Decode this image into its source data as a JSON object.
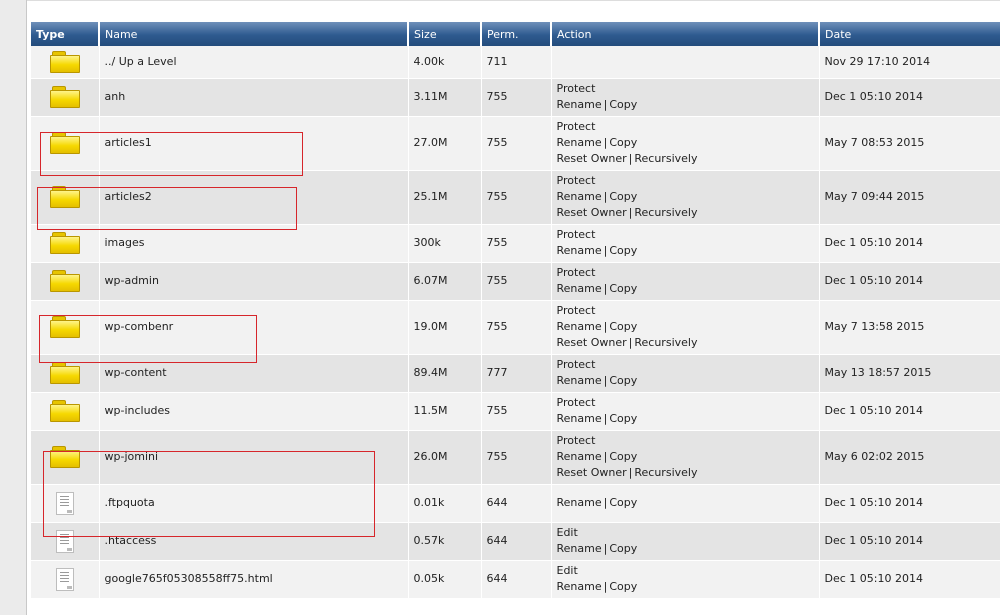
{
  "columns": {
    "type": "Type",
    "name": "Name",
    "size": "Size",
    "perm": "Perm.",
    "action": "Action",
    "date": "Date"
  },
  "actions": {
    "protect": "Protect",
    "rename": "Rename",
    "copy": "Copy",
    "reset_owner": "Reset Owner",
    "recursively": "Recursively",
    "edit": "Edit",
    "separator": "|"
  },
  "rows": [
    {
      "kind": "folder",
      "name": "../ Up a Level",
      "size": "4.00k",
      "perm": "711",
      "date": "Nov 29 17:10 2014",
      "actions": [],
      "highlight": false
    },
    {
      "kind": "folder",
      "name": "anh",
      "size": "3.11M",
      "perm": "755",
      "date": "Dec 1 05:10 2014",
      "actions": [
        "protect",
        "rename_copy"
      ],
      "highlight": false
    },
    {
      "kind": "folder",
      "name": "articles1",
      "size": "27.0M",
      "perm": "755",
      "date": "May 7 08:53 2015",
      "actions": [
        "protect",
        "rename_copy",
        "reset"
      ],
      "highlight": true
    },
    {
      "kind": "folder",
      "name": "articles2",
      "size": "25.1M",
      "perm": "755",
      "date": "May 7 09:44 2015",
      "actions": [
        "protect",
        "rename_copy",
        "reset"
      ],
      "highlight": true
    },
    {
      "kind": "folder",
      "name": "images",
      "size": "300k",
      "perm": "755",
      "date": "Dec 1 05:10 2014",
      "actions": [
        "protect",
        "rename_copy"
      ],
      "highlight": false
    },
    {
      "kind": "folder",
      "name": "wp-admin",
      "size": "6.07M",
      "perm": "755",
      "date": "Dec 1 05:10 2014",
      "actions": [
        "protect",
        "rename_copy"
      ],
      "highlight": false
    },
    {
      "kind": "folder",
      "name": "wp-combenr",
      "size": "19.0M",
      "perm": "755",
      "date": "May 7 13:58 2015",
      "actions": [
        "protect",
        "rename_copy",
        "reset"
      ],
      "highlight": true
    },
    {
      "kind": "folder",
      "name": "wp-content",
      "size": "89.4M",
      "perm": "777",
      "date": "May 13 18:57 2015",
      "actions": [
        "protect",
        "rename_copy"
      ],
      "highlight": false
    },
    {
      "kind": "folder",
      "name": "wp-includes",
      "size": "11.5M",
      "perm": "755",
      "date": "Dec 1 05:10 2014",
      "actions": [
        "protect",
        "rename_copy"
      ],
      "highlight": false
    },
    {
      "kind": "folder",
      "name": "wp-jomini",
      "size": "26.0M",
      "perm": "755",
      "date": "May 6 02:02 2015",
      "actions": [
        "protect",
        "rename_copy",
        "reset"
      ],
      "highlight": true
    },
    {
      "kind": "file",
      "name": ".ftpquota",
      "size": "0.01k",
      "perm": "644",
      "date": "Dec 1 05:10 2014",
      "actions": [
        "rename_copy"
      ],
      "highlight": true
    },
    {
      "kind": "file",
      "name": ".htaccess",
      "size": "0.57k",
      "perm": "644",
      "date": "Dec 1 05:10 2014",
      "actions": [
        "edit",
        "rename_copy"
      ],
      "highlight": false
    },
    {
      "kind": "file",
      "name": "google765f05308558ff75.html",
      "size": "0.05k",
      "perm": "644",
      "date": "Dec 1 05:10 2014",
      "actions": [
        "edit",
        "rename_copy"
      ],
      "highlight": false
    }
  ],
  "colors": {
    "header": "#2e5a8f",
    "row_light": "#f2f2f2",
    "row_dark": "#e4e4e4",
    "highlight": "#d6262b",
    "folder": "#f6d800"
  },
  "icons": {
    "folder": "folder-icon",
    "file": "file-icon"
  }
}
